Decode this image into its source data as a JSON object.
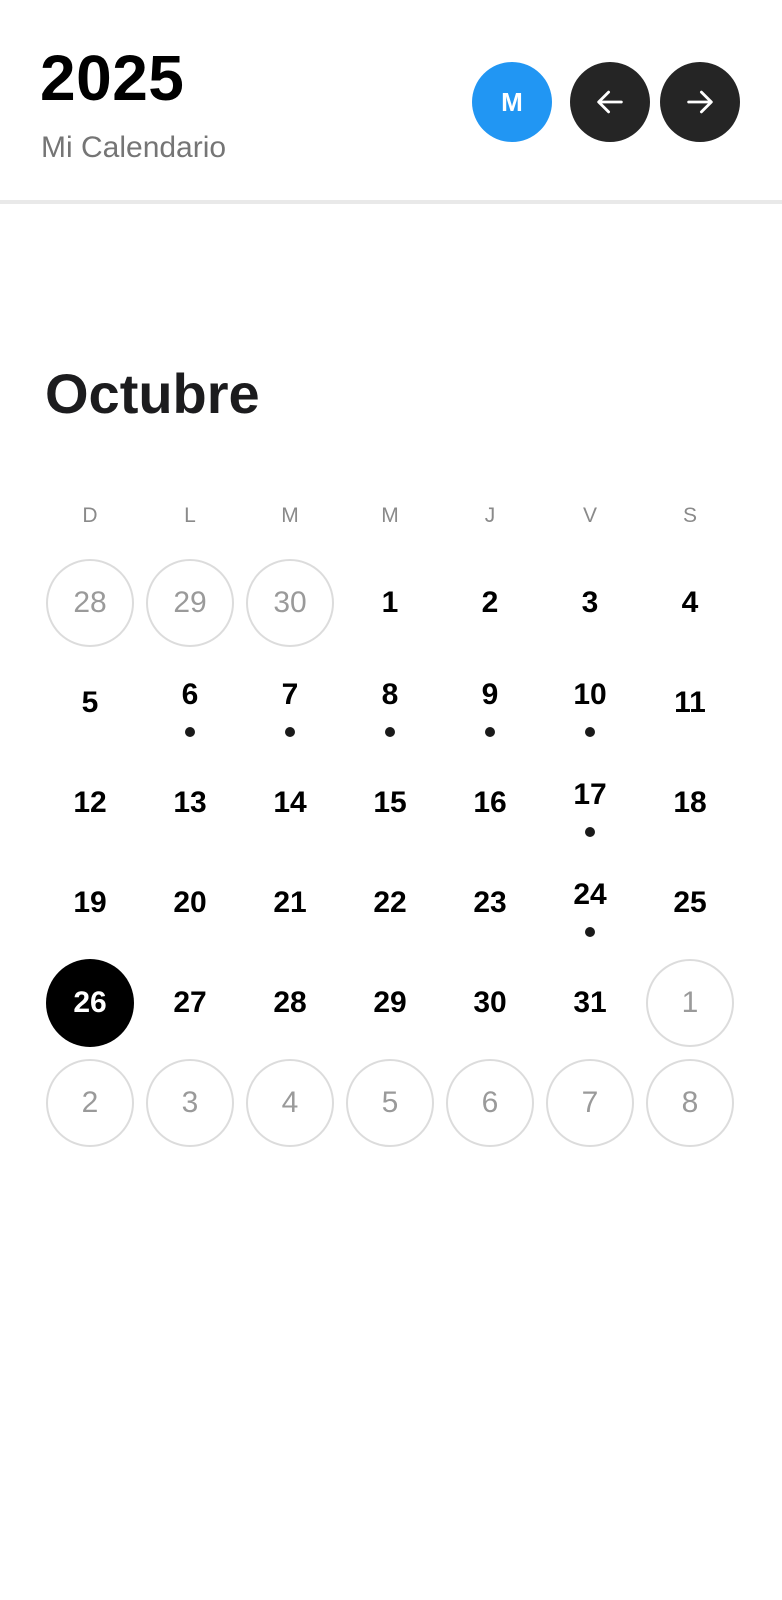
{
  "header": {
    "year": "2025",
    "subtitle": "Mi Calendario",
    "avatar_initial": "M",
    "avatar_color": "#2196f3",
    "prev_icon": "arrow-left-icon",
    "next_icon": "arrow-right-icon"
  },
  "month": {
    "title": "Octubre",
    "weekdays": [
      "D",
      "L",
      "M",
      "M",
      "J",
      "V",
      "S"
    ],
    "selected_color": "#000000",
    "days": [
      {
        "label": "28",
        "outside": true,
        "event": false,
        "selected": false
      },
      {
        "label": "29",
        "outside": true,
        "event": false,
        "selected": false
      },
      {
        "label": "30",
        "outside": true,
        "event": false,
        "selected": false
      },
      {
        "label": "1",
        "outside": false,
        "event": false,
        "selected": false
      },
      {
        "label": "2",
        "outside": false,
        "event": false,
        "selected": false
      },
      {
        "label": "3",
        "outside": false,
        "event": false,
        "selected": false
      },
      {
        "label": "4",
        "outside": false,
        "event": false,
        "selected": false
      },
      {
        "label": "5",
        "outside": false,
        "event": false,
        "selected": false
      },
      {
        "label": "6",
        "outside": false,
        "event": true,
        "selected": false
      },
      {
        "label": "7",
        "outside": false,
        "event": true,
        "selected": false
      },
      {
        "label": "8",
        "outside": false,
        "event": true,
        "selected": false
      },
      {
        "label": "9",
        "outside": false,
        "event": true,
        "selected": false
      },
      {
        "label": "10",
        "outside": false,
        "event": true,
        "selected": false
      },
      {
        "label": "11",
        "outside": false,
        "event": false,
        "selected": false
      },
      {
        "label": "12",
        "outside": false,
        "event": false,
        "selected": false
      },
      {
        "label": "13",
        "outside": false,
        "event": false,
        "selected": false
      },
      {
        "label": "14",
        "outside": false,
        "event": false,
        "selected": false
      },
      {
        "label": "15",
        "outside": false,
        "event": false,
        "selected": false
      },
      {
        "label": "16",
        "outside": false,
        "event": false,
        "selected": false
      },
      {
        "label": "17",
        "outside": false,
        "event": true,
        "selected": false
      },
      {
        "label": "18",
        "outside": false,
        "event": false,
        "selected": false
      },
      {
        "label": "19",
        "outside": false,
        "event": false,
        "selected": false
      },
      {
        "label": "20",
        "outside": false,
        "event": false,
        "selected": false
      },
      {
        "label": "21",
        "outside": false,
        "event": false,
        "selected": false
      },
      {
        "label": "22",
        "outside": false,
        "event": false,
        "selected": false
      },
      {
        "label": "23",
        "outside": false,
        "event": false,
        "selected": false
      },
      {
        "label": "24",
        "outside": false,
        "event": true,
        "selected": false
      },
      {
        "label": "25",
        "outside": false,
        "event": false,
        "selected": false
      },
      {
        "label": "26",
        "outside": false,
        "event": false,
        "selected": true
      },
      {
        "label": "27",
        "outside": false,
        "event": false,
        "selected": false
      },
      {
        "label": "28",
        "outside": false,
        "event": false,
        "selected": false
      },
      {
        "label": "29",
        "outside": false,
        "event": false,
        "selected": false
      },
      {
        "label": "30",
        "outside": false,
        "event": false,
        "selected": false
      },
      {
        "label": "31",
        "outside": false,
        "event": false,
        "selected": false
      },
      {
        "label": "1",
        "outside": true,
        "event": false,
        "selected": false
      },
      {
        "label": "2",
        "outside": true,
        "event": false,
        "selected": false
      },
      {
        "label": "3",
        "outside": true,
        "event": false,
        "selected": false
      },
      {
        "label": "4",
        "outside": true,
        "event": false,
        "selected": false
      },
      {
        "label": "5",
        "outside": true,
        "event": false,
        "selected": false
      },
      {
        "label": "6",
        "outside": true,
        "event": false,
        "selected": false
      },
      {
        "label": "7",
        "outside": true,
        "event": false,
        "selected": false
      },
      {
        "label": "8",
        "outside": true,
        "event": false,
        "selected": false
      }
    ]
  }
}
